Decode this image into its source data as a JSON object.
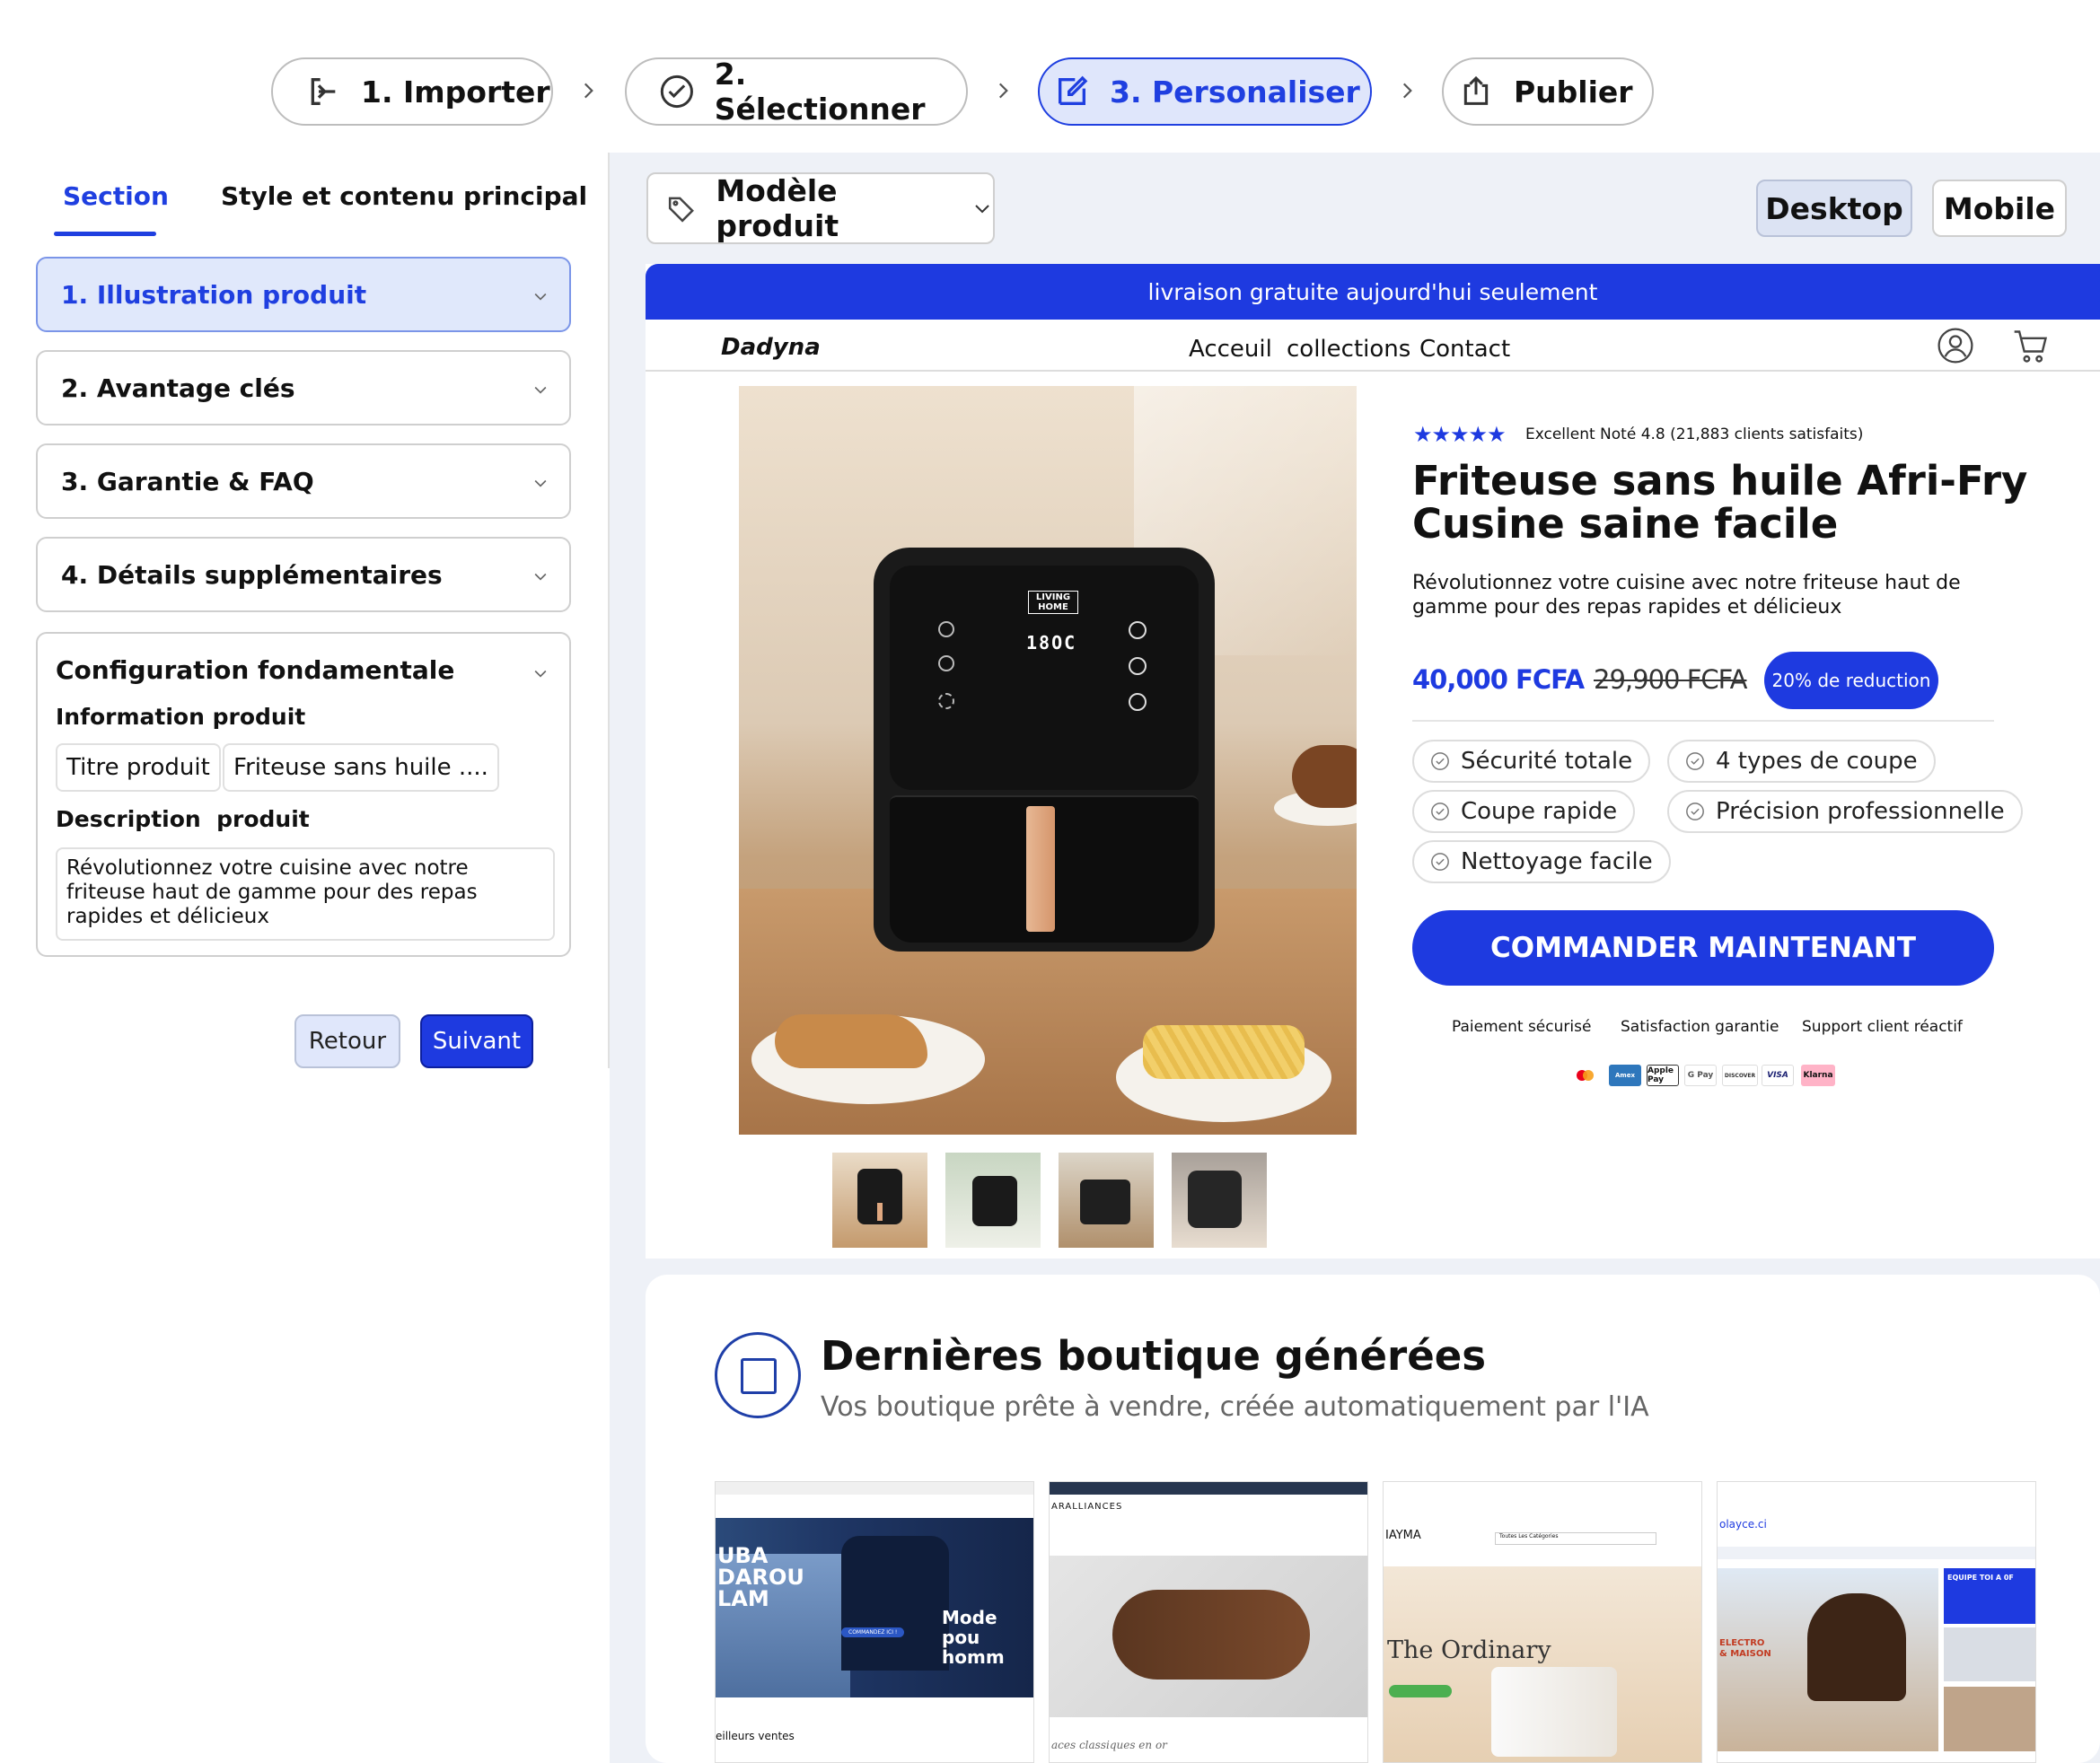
{
  "stepper": {
    "steps": [
      {
        "label": "1. Importer",
        "icon": "import-icon"
      },
      {
        "label": "2. Sélectionner",
        "icon": "check-circle-icon"
      },
      {
        "label": "3. Personaliser",
        "icon": "edit-icon"
      },
      {
        "label": "Publier",
        "icon": "share-icon"
      }
    ],
    "active_index": 2
  },
  "left_panel": {
    "tabs": [
      "Section",
      "Style et contenu principal"
    ],
    "active_tab": "Section",
    "sections": [
      "1. Illustration produit",
      "2. Avantage clés",
      "3. Garantie & FAQ",
      "4. Détails supplémentaires"
    ],
    "config": {
      "title": "Configuration fondamentale",
      "info_label": "Information produit",
      "title_field_label": "Titre produit",
      "title_field_value": "Friteuse sans huile ....",
      "desc_label": "Description  produit",
      "desc_value": "Révolutionnez votre cuisine avec notre friteuse haut de gamme pour des repas rapides et délicieux"
    },
    "back_button": "Retour",
    "next_button": "Suivant"
  },
  "toolbar": {
    "template_select": "Modèle produit",
    "view_desktop": "Desktop",
    "view_mobile": "Mobile",
    "active_view": "Desktop"
  },
  "store_preview": {
    "banner": "livraison gratuite aujourd'hui seulement",
    "brand": "Dadyna",
    "nav": [
      "Acceuil",
      "collections",
      "Contact"
    ],
    "rating_text": "Excellent Noté 4.8 (21,883 clients satisfaits)",
    "stars": 5,
    "title_line1": "Friteuse sans huile Afri-Fry",
    "title_line2": "Cusine saine facile",
    "subtitle": "Révolutionnez votre cuisine avec notre friteuse haut de gamme pour des repas rapides et délicieux",
    "price": "40,000 FCFA",
    "old_price": "29,900 FCFA",
    "discount_badge": "20% de reduction",
    "features": [
      "Sécurité totale",
      "4 types de coupe",
      "Coupe rapide",
      "Précision professionnelle",
      "Nettoyage facile"
    ],
    "cta": "COMMANDER MAINTENANT",
    "trust": [
      "Paiement sécurisé",
      "Satisfaction garantie",
      "Support client réactif"
    ],
    "payment_methods": [
      "Mastercard",
      "Amex",
      "Apple Pay",
      "G Pay",
      "DISCOVER",
      "VISA",
      "Klarna"
    ],
    "product_display": "18OC",
    "product_brand": "LIVING HOME",
    "accent": "#1e3ae0"
  },
  "generated_section": {
    "title": "Dernières boutique générées",
    "subtitle": "Vos boutique prête à vendre, créée automatiquement par l'IA",
    "shops": [
      {
        "headline": "UBA DAROU LAM",
        "overlay": "Mode pou homm",
        "cta": "COMMANDEZ ICI !",
        "footer": "eilleurs ventes"
      },
      {
        "brand": "ARALLIANCES",
        "footer": "aces classiques en or"
      },
      {
        "brand": "IAYMA",
        "headline": "The Ordinary",
        "search": "Toutes Les Catégories"
      },
      {
        "brand": "olayce.ci",
        "category": "ELECTRO & MAISON",
        "promo": "EQUIPE TOI A 0F"
      }
    ]
  }
}
